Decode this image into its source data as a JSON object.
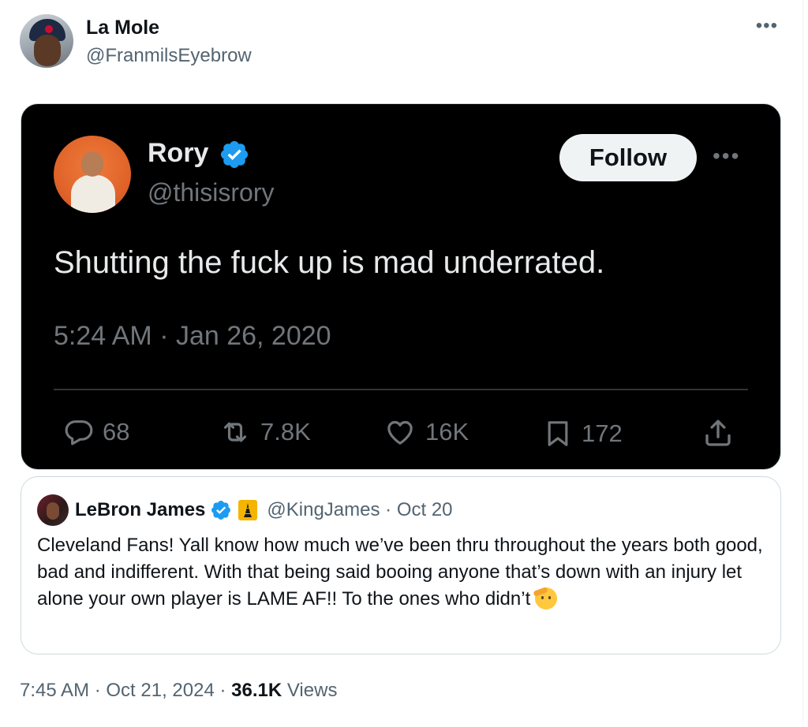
{
  "tweet": {
    "author": {
      "name": "La Mole",
      "handle": "@FranmilsEyebrow"
    },
    "more_label": "•••",
    "embedded_image": {
      "name": "Rory",
      "handle": "@thisisrory",
      "follow_label": "Follow",
      "more_label": "•••",
      "text": "Shutting the fuck up is mad underrated.",
      "timestamp": "5:24 AM · Jan 26, 2020",
      "stats": {
        "replies": "68",
        "retweets": "7.8K",
        "likes": "16K",
        "bookmarks": "172"
      }
    },
    "quoted": {
      "name": "LeBron James",
      "handle_date": "@KingJames · Oct 20",
      "text": "Cleveland Fans! Yall know how much we’ve been thru throughout the years both good, bad and indifferent. With that being said booing anyone that’s down with an injury let alone your own player is LAME AF!!  To the ones who didn’t"
    },
    "footer": {
      "time": "7:45 AM · Oct 21, 2024 · ",
      "views_count": "36.1K",
      "views_label": " Views"
    }
  },
  "colors": {
    "verified_blue": "#1d9bf0",
    "dark_bg": "#000000",
    "text_primary": "#0f1419",
    "text_secondary": "#536471"
  },
  "icons": [
    "reply-icon",
    "retweet-icon",
    "like-icon",
    "bookmark-icon",
    "share-icon",
    "verified-badge-icon",
    "affiliate-badge-icon",
    "salute-emoji"
  ]
}
